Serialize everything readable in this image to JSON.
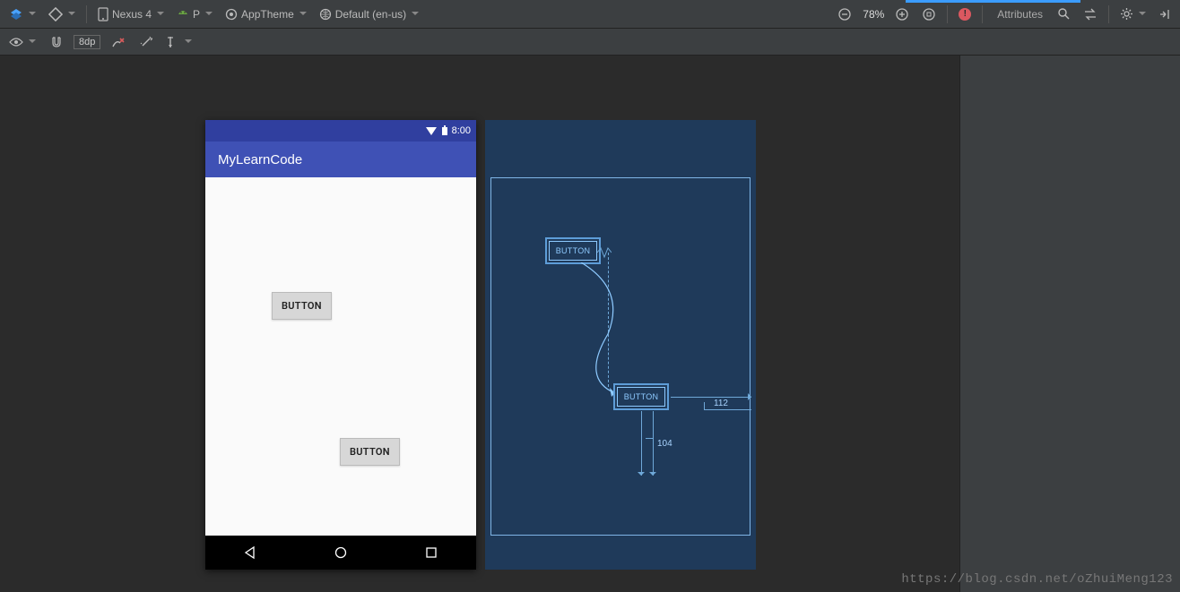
{
  "toolbar": {
    "device": "Nexus 4",
    "api_badge": "P",
    "theme_label": "AppTheme",
    "locale_label": "Default (en-us)",
    "zoom": "78%",
    "panel_label": "Attributes"
  },
  "toolbar2": {
    "dp_value": "8dp"
  },
  "device_preview": {
    "status_time": "8:00",
    "app_title": "MyLearnCode",
    "button1_label": "BUTTON",
    "button2_label": "BUTTON"
  },
  "blueprint": {
    "button1_label": "BUTTON",
    "button2_label": "BUTTON",
    "dim_right": "112",
    "dim_bottom": "104"
  },
  "watermark": "https://blog.csdn.net/oZhuiMeng123"
}
